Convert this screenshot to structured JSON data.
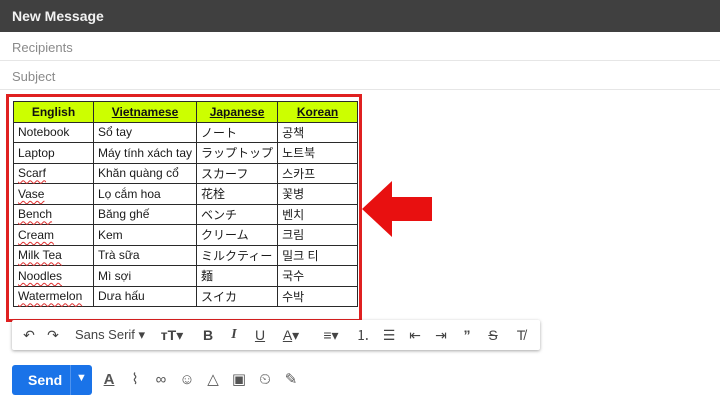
{
  "window": {
    "title": "New Message"
  },
  "fields": {
    "recipients": "Recipients",
    "subject": "Subject"
  },
  "table": {
    "headers": [
      "English",
      "Vietnamese",
      "Japanese",
      "Korean"
    ],
    "rows": [
      [
        "Notebook",
        "Sổ tay",
        "ノート",
        "공책"
      ],
      [
        "Laptop",
        "Máy tính xách tay",
        "ラップトップ",
        "노트북"
      ],
      [
        "Scarf",
        "Khăn quàng cổ",
        "スカーフ",
        "스카프"
      ],
      [
        "Vase",
        "Lọ cắm hoa",
        "花栓",
        "꽃병"
      ],
      [
        "Bench",
        "Băng ghế",
        "ベンチ",
        "벤치"
      ],
      [
        "Cream",
        "Kem",
        "クリーム",
        "크림"
      ],
      [
        "Milk Tea",
        "Trà sữa",
        "ミルクティー",
        "밀크 티"
      ],
      [
        "Noodles",
        "Mì sợi",
        "麺",
        "국수"
      ],
      [
        "Watermelon",
        "Dưa hấu",
        "スイカ",
        "수박"
      ]
    ]
  },
  "colors": {
    "highlight": "#e02020",
    "header_fill": "#ccff00",
    "send": "#1a73e8"
  },
  "toolbar": {
    "font": "Sans Serif",
    "icons": [
      "undo-icon",
      "redo-icon",
      "font-select",
      "font-size-icon",
      "bold-icon",
      "italic-icon",
      "underline-icon",
      "text-color-icon",
      "align-icon",
      "numbered-list-icon",
      "bulleted-list-icon",
      "indent-less-icon",
      "indent-more-icon",
      "quote-icon",
      "strikethrough-icon",
      "clear-format-icon"
    ]
  },
  "sendbar": {
    "send_label": "Send",
    "icons": [
      "formatting-icon",
      "attach-icon",
      "link-icon",
      "emoji-icon",
      "drive-icon",
      "photo-icon",
      "confidential-icon",
      "signature-icon"
    ]
  }
}
